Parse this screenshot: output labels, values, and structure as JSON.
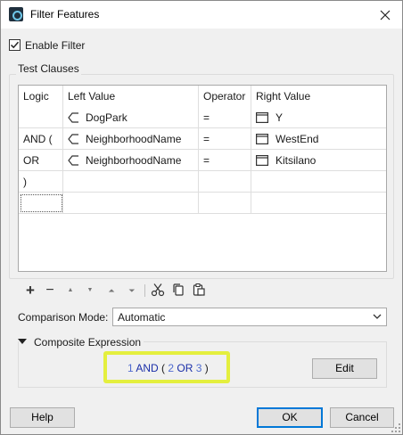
{
  "window": {
    "title": "Filter Features"
  },
  "enable_filter": {
    "label": "Enable Filter",
    "checked": true
  },
  "test_clauses": {
    "label": "Test Clauses",
    "columns": [
      "Logic",
      "Left Value",
      "Operator",
      "Right Value"
    ],
    "rows": [
      {
        "logic": "",
        "left": "DogPark",
        "operator": "=",
        "right": "Y"
      },
      {
        "logic": "AND (",
        "left": "NeighborhoodName",
        "operator": "=",
        "right": "WestEnd"
      },
      {
        "logic": "OR",
        "left": "NeighborhoodName",
        "operator": "=",
        "right": "Kitsilano"
      },
      {
        "logic": ")",
        "left": "",
        "operator": "",
        "right": ""
      },
      {
        "logic": "",
        "left": "",
        "operator": "",
        "right": ""
      }
    ]
  },
  "toolbar": {
    "add": "+",
    "remove": "−",
    "move_up": "▲",
    "move_down": "▼",
    "move_top": "⏶",
    "move_bottom": "⏷"
  },
  "comparison_mode": {
    "label": "Comparison Mode:",
    "value": "Automatic"
  },
  "composite": {
    "label": "Composite Expression",
    "tokens": {
      "t1": "1",
      "and": "AND",
      "lp": "(",
      "t2": "2",
      "or": "OR",
      "t3": "3",
      "rp": ")"
    },
    "edit_label": "Edit",
    "highlight_color": "#e4ef3e"
  },
  "buttons": {
    "help": "Help",
    "ok": "OK",
    "cancel": "Cancel"
  },
  "colors": {
    "accent": "#0078d7",
    "token_id": "#4f6bd0",
    "token_kw": "#1a2ea8"
  }
}
